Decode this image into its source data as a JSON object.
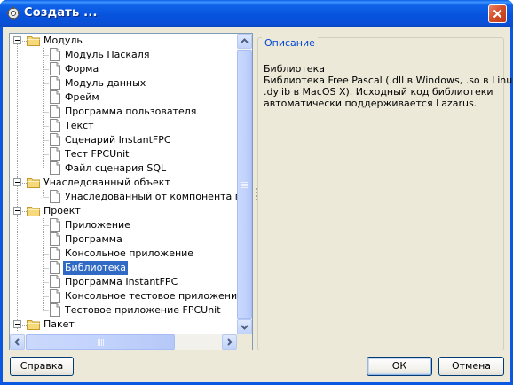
{
  "window": {
    "title": "Создать ...",
    "icon": "gear-icon",
    "close_icon": "close-icon"
  },
  "tree": {
    "rows": [
      {
        "label": "Модуль",
        "type": "folder",
        "level": 0,
        "expanded": true
      },
      {
        "label": "Модуль Паскаля",
        "type": "item",
        "level": 1
      },
      {
        "label": "Форма",
        "type": "item",
        "level": 1
      },
      {
        "label": "Модуль данных",
        "type": "item",
        "level": 1
      },
      {
        "label": "Фрейм",
        "type": "item",
        "level": 1
      },
      {
        "label": "Программа пользователя",
        "type": "item",
        "level": 1
      },
      {
        "label": "Текст",
        "type": "item",
        "level": 1
      },
      {
        "label": "Сценарий InstantFPC",
        "type": "item",
        "level": 1
      },
      {
        "label": "Тест FPCUnit",
        "type": "item",
        "level": 1
      },
      {
        "label": "Файл сценария SQL",
        "type": "item",
        "level": 1
      },
      {
        "label": "Унаследованный объект",
        "type": "folder",
        "level": 0,
        "expanded": true
      },
      {
        "label": "Унаследованный от компонента проекта",
        "type": "item",
        "level": 1
      },
      {
        "label": "Проект",
        "type": "folder",
        "level": 0,
        "expanded": true
      },
      {
        "label": "Приложение",
        "type": "item",
        "level": 1
      },
      {
        "label": "Программа",
        "type": "item",
        "level": 1
      },
      {
        "label": "Консольное приложение",
        "type": "item",
        "level": 1
      },
      {
        "label": "Библиотека",
        "type": "item",
        "level": 1,
        "selected": true
      },
      {
        "label": "Программа InstantFPC",
        "type": "item",
        "level": 1
      },
      {
        "label": "Консольное тестовое приложение FPCUnit",
        "type": "item",
        "level": 1
      },
      {
        "label": "Тестовое приложение FPCUnit",
        "type": "item",
        "level": 1
      },
      {
        "label": "Пакет",
        "type": "folder",
        "level": 0,
        "expanded": true
      }
    ]
  },
  "description": {
    "legend": "Описание",
    "lines": [
      "Библиотека",
      "Библиотека Free Pascal (.dll в Windows, .so в Linux,",
      ".dylib в MacOS X). Исходный код библиотеки",
      "автоматически поддерживается Lazarus."
    ]
  },
  "buttons": {
    "help": "Справка",
    "ok": "ОК",
    "cancel": "Отмена"
  },
  "colors": {
    "titlebar": "#0a58e2",
    "selection": "#316ac5",
    "dialog_bg": "#ece9d8",
    "legend_text": "#0046d5"
  }
}
